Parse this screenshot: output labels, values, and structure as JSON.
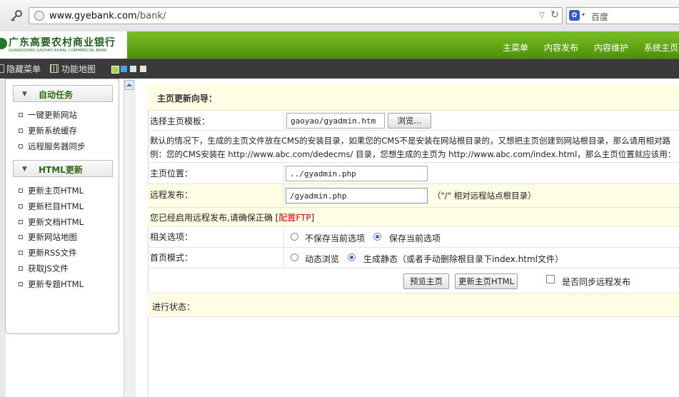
{
  "browser": {
    "url_host": "www.gyebank.com",
    "url_path": "/bank/",
    "search_engine": "百度"
  },
  "header": {
    "logo_cn": "广东高要农村商业银行",
    "logo_en": "GUANGDONG GAOYAO RURAL COMMERCIAL BANK",
    "nav": [
      "主菜单",
      "内容发布",
      "内容维护",
      "系统主页"
    ]
  },
  "toolbar": {
    "hide_menu": "隐藏菜单",
    "site_map": "功能地图"
  },
  "sidebar": {
    "sections": [
      {
        "title": "自动任务",
        "items": [
          "一键更新网站",
          "更新系统缓存",
          "远程服务器同步"
        ]
      },
      {
        "title": "HTML更新",
        "items": [
          "更新主页HTML",
          "更新栏目HTML",
          "更新文档HTML",
          "更新网站地图",
          "更新RSS文件",
          "获取JS文件",
          "更新专题HTML"
        ]
      }
    ]
  },
  "main": {
    "title": "主页更新向导：",
    "template_label": "选择主页模板：",
    "template_value": "gaoyao/gyadmin.htm",
    "browse_button": "浏览...",
    "note_line1": "默认的情况下，生成的主页文件放在CMS的安装目录，如果您的CMS不是安装在网站根目录的，又想把主页创建到网站根目录，那么请用相对路",
    "note_line2": "例：您的CMS安装在 http://www.abc.com/dedecms/ 目录，您想生成的主页为 http://www.abc.com/index.html，那么主页位置就应该用：",
    "position_label": "主页位置：",
    "position_value": "../gyadmin.php",
    "remote_label": "远程发布：",
    "remote_value": "/gyadmin.php",
    "remote_hint": "（\"/\" 相对远程站点根目录）",
    "ftp_notice_prefix": "您已经启用远程发布,请确保正确 [",
    "ftp_link": "配置FTP",
    "ftp_notice_suffix": "]",
    "options_label": "相关选项：",
    "option_no_save": "不保存当前选项",
    "option_save": "保存当前选项",
    "mode_label": "首页模式：",
    "mode_dynamic": "动态浏览",
    "mode_static": "生成静态（或者手动删除根目录下index.html文件）",
    "preview_button": "预览主页",
    "update_button": "更新主页HTML",
    "sync_checkbox": "是否同步远程发布",
    "progress_label": "进行状态："
  },
  "colors": {
    "header_green": "#5ea314",
    "dark_bar": "#3a3a3a",
    "highlight_row": "#fffde3",
    "link_red": "#cc0000"
  }
}
